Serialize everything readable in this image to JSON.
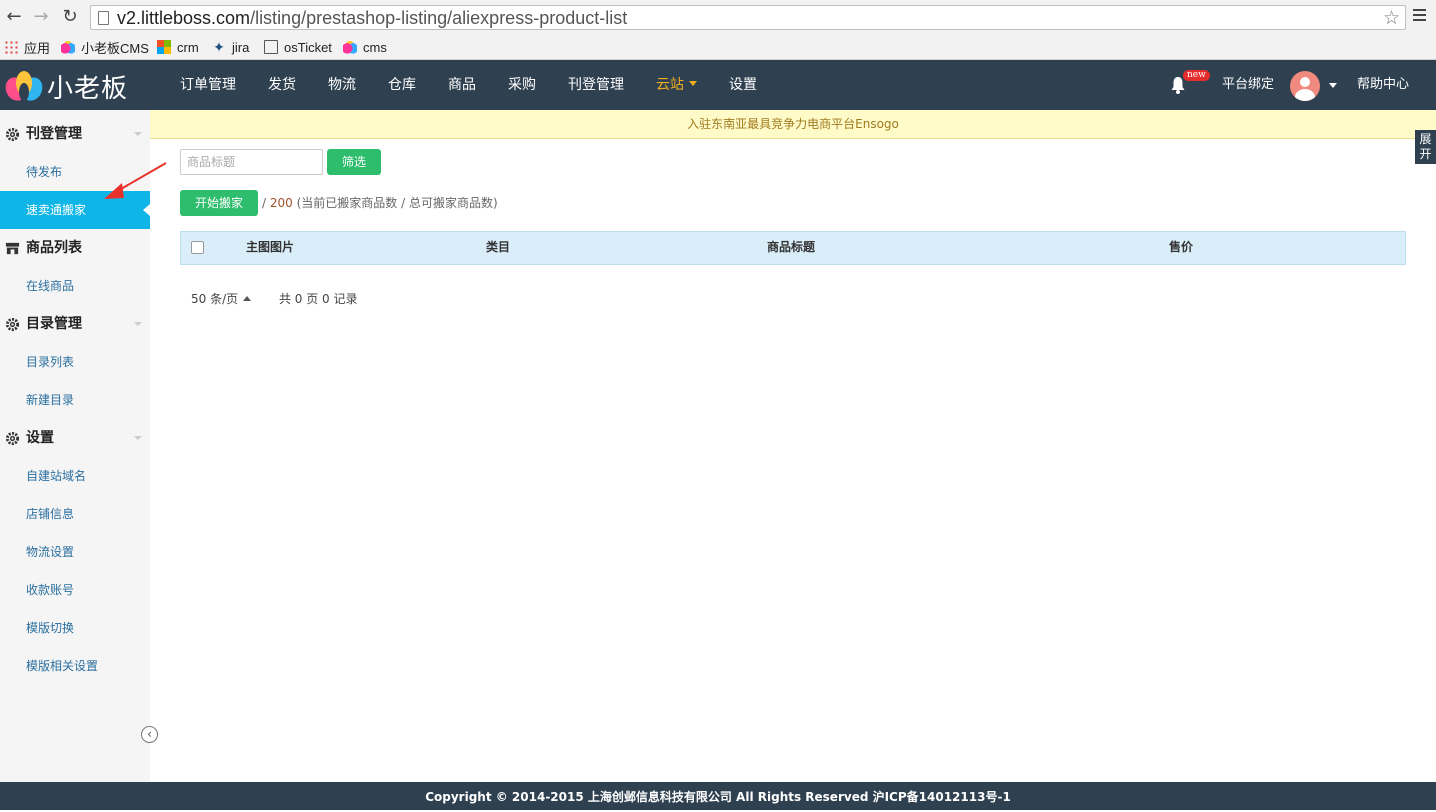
{
  "browser": {
    "url_host": "v2.littleboss.com",
    "url_path": "/listing/prestashop-listing/aliexpress-product-list",
    "bookmarks": [
      {
        "label": "应用",
        "icon": "apps-icon"
      },
      {
        "label": "小老板CMS",
        "icon": "lotus-icon"
      },
      {
        "label": "crm",
        "icon": "windows-icon"
      },
      {
        "label": "jira",
        "icon": "jira-icon"
      },
      {
        "label": "osTicket",
        "icon": "document-icon"
      },
      {
        "label": "cms",
        "icon": "lotus-icon"
      }
    ]
  },
  "header": {
    "logo_text": "小老板",
    "nav": [
      {
        "label": "订单管理"
      },
      {
        "label": "发货"
      },
      {
        "label": "物流"
      },
      {
        "label": "仓库"
      },
      {
        "label": "商品"
      },
      {
        "label": "采购"
      },
      {
        "label": "刊登管理"
      },
      {
        "label": "云站",
        "active": true
      },
      {
        "label": "设置"
      }
    ],
    "badge": "new",
    "platform_bind": "平台绑定",
    "help": "帮助中心",
    "active_color": "#f0ad1f",
    "bg_color": "#2f4050"
  },
  "sidebar": {
    "groups": [
      {
        "label": "刊登管理",
        "icon": "gear-icon",
        "items": [
          "待发布",
          "速卖通搬家"
        ]
      },
      {
        "label": "商品列表",
        "icon": "store-icon",
        "items": [
          "在线商品"
        ]
      },
      {
        "label": "目录管理",
        "icon": "gear-icon",
        "items": [
          "目录列表",
          "新建目录"
        ]
      },
      {
        "label": "设置",
        "icon": "gear-icon",
        "items": [
          "自建站域名",
          "店铺信息",
          "物流设置",
          "收款账号",
          "模版切换",
          "模版相关设置"
        ]
      }
    ],
    "active_item": "速卖通搬家",
    "active_color": "#0fb5e6"
  },
  "notice": "入驻东南亚最具竞争力电商平台Ensogo",
  "expand_tab": [
    "展",
    "开"
  ],
  "filter": {
    "placeholder": "商品标题",
    "button": "筛选"
  },
  "move": {
    "button": "开始搬家",
    "slash": "/",
    "total": "200",
    "desc": "(当前已搬家商品数 / 总可搬家商品数)"
  },
  "table": {
    "columns": [
      "主图图片",
      "类目",
      "商品标题",
      "售价"
    ]
  },
  "pager": {
    "page_size": "50 条/页",
    "summary": "共 0 页 0 记录"
  },
  "footer": "Copyright © 2014-2015 上海创邺信息科技有限公司 All Rights Reserved 沪ICP备14012113号-1"
}
